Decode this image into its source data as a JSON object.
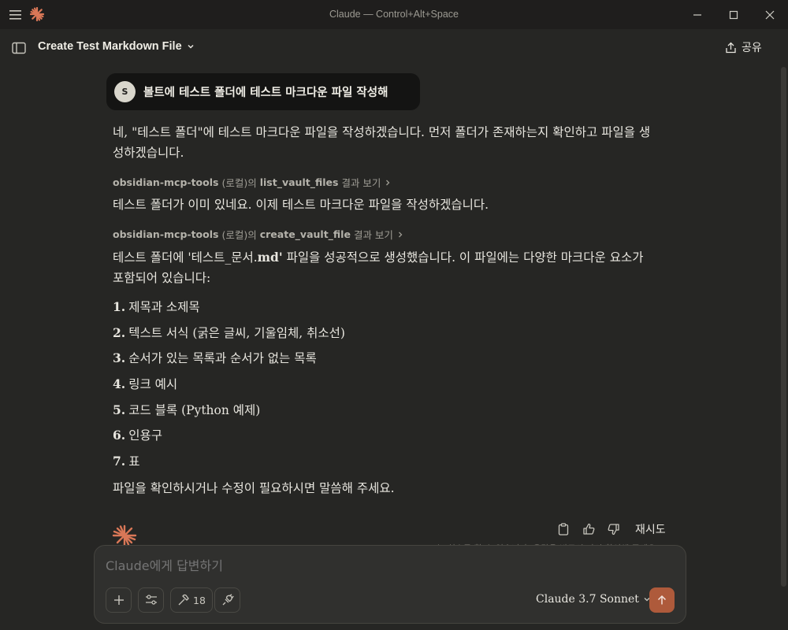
{
  "window": {
    "title": "Claude — Control+Alt+Space"
  },
  "header": {
    "chat_title": "Create Test Markdown File",
    "share_label": "공유"
  },
  "user_message": {
    "avatar_initial": "S",
    "text": "볼트에 테스트 폴더에 테스트 마크다운 파일 작성해"
  },
  "assistant": {
    "para1": "네, \"테스트 폴더\"에 테스트 마크다운 파일을 작성하겠습니다. 먼저 폴더가 존재하는지 확인하고 파일을 생성하겠습니다.",
    "tool1": {
      "server": "obsidian-mcp-tools",
      "scope": "(로컬)의",
      "tool": "list_vault_files",
      "view_label": "결과 보기"
    },
    "para2": "테스트 폴더가 이미 있네요. 이제 테스트 마크다운 파일을 작성하겠습니다.",
    "tool2": {
      "server": "obsidian-mcp-tools",
      "scope": "(로컬)의",
      "tool": "create_vault_file",
      "view_label": "결과 보기"
    },
    "para3_before": "테스트 폴더에 '테스트_문서.",
    "para3_bold": "md'",
    "para3_after": " 파일을 성공적으로 생성했습니다. 이 파일에는 다양한 마크다운 요소가 포함되어 있습니다:",
    "list": [
      {
        "num": "1.",
        "text": "제목과 소제목"
      },
      {
        "num": "2.",
        "text": "텍스트 서식 (굵은 글씨, 기울임체, 취소선)"
      },
      {
        "num": "3.",
        "text": "순서가 있는 목록과 순서가 없는 목록"
      },
      {
        "num": "4.",
        "text": "링크 예시"
      },
      {
        "num": "5.",
        "text": "코드 블록 (Python 예제)"
      },
      {
        "num": "6.",
        "text": "인용구"
      },
      {
        "num": "7.",
        "text": "표"
      }
    ],
    "para4": "파일을 확인하시거나 수정이 필요하시면 말씀해 주세요.",
    "retry_label": "재시도",
    "footnote": "Claude는 실수를 할 수 있습니다. 응답을 반드시 다시 확인해 주세요."
  },
  "composer": {
    "placeholder": "Claude에게 답변하기",
    "tool_count": "18",
    "model": "Claude 3.7 Sonnet"
  },
  "colors": {
    "accent": "#d97757",
    "send": "#ae5a3b",
    "background": "#262624"
  }
}
